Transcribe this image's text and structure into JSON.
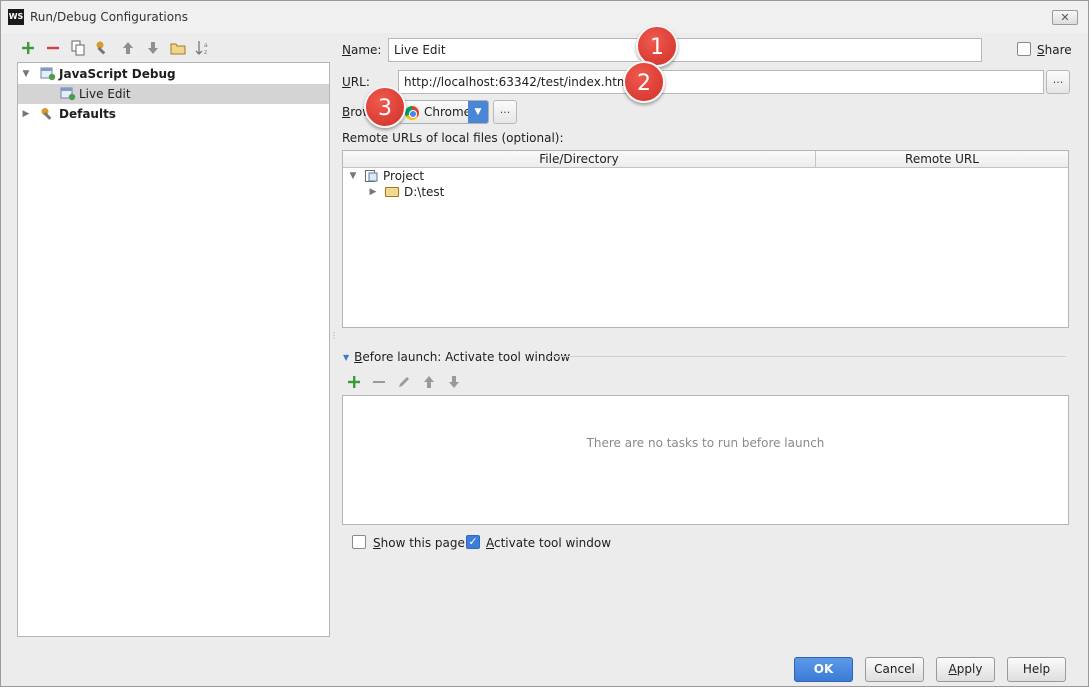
{
  "window": {
    "title": "Run/Debug Configurations",
    "app_logo": "WS",
    "close_glyph": "✕"
  },
  "left_toolbar": {
    "icons": [
      "add-icon",
      "remove-icon",
      "copy-icon",
      "wrench-icon",
      "move-up-icon",
      "move-down-icon",
      "folder-icon",
      "sort-icon"
    ]
  },
  "tree": {
    "items": [
      {
        "label": "JavaScript Debug",
        "level": 0,
        "expanded": true,
        "bold": true
      },
      {
        "label": "Live Edit",
        "level": 1,
        "selected": true
      },
      {
        "label": "Defaults",
        "level": 0,
        "expanded": false,
        "bold": true
      }
    ]
  },
  "form": {
    "name_label": "Name:",
    "name_value": "Live Edit",
    "share_label": "Share",
    "share_checked": false,
    "url_label": "URL:",
    "url_value": "http://localhost:63342/test/index.html",
    "url_browse": "...",
    "browser_label": "Brow",
    "browser_value": "Chrome",
    "browser_more": "...",
    "remote_urls_label": "Remote URLs of local files (optional):"
  },
  "mapping_table": {
    "columns": [
      "File/Directory",
      "Remote URL"
    ],
    "rows": [
      {
        "label": "Project",
        "level": 0,
        "expanded": true
      },
      {
        "label": "D:\\test",
        "level": 1,
        "expanded": false
      }
    ]
  },
  "before_launch": {
    "title": "Before launch: Activate tool window",
    "toolbar_icons": [
      "add-icon",
      "remove-icon",
      "edit-icon",
      "move-up-icon",
      "move-down-icon"
    ],
    "empty_text": "There are no tasks to run before launch",
    "show_page_label": "Show this page",
    "show_page_checked": false,
    "activate_label": "Activate tool window",
    "activate_checked": true
  },
  "buttons": {
    "ok": "OK",
    "cancel": "Cancel",
    "apply": "Apply",
    "help": "Help"
  },
  "callouts": [
    "1",
    "2",
    "3"
  ],
  "colors": {
    "accent": "#3b7bd6",
    "callout": "#d9342b",
    "add_green": "#3a9b3a",
    "remove_red": "#d0403a"
  }
}
